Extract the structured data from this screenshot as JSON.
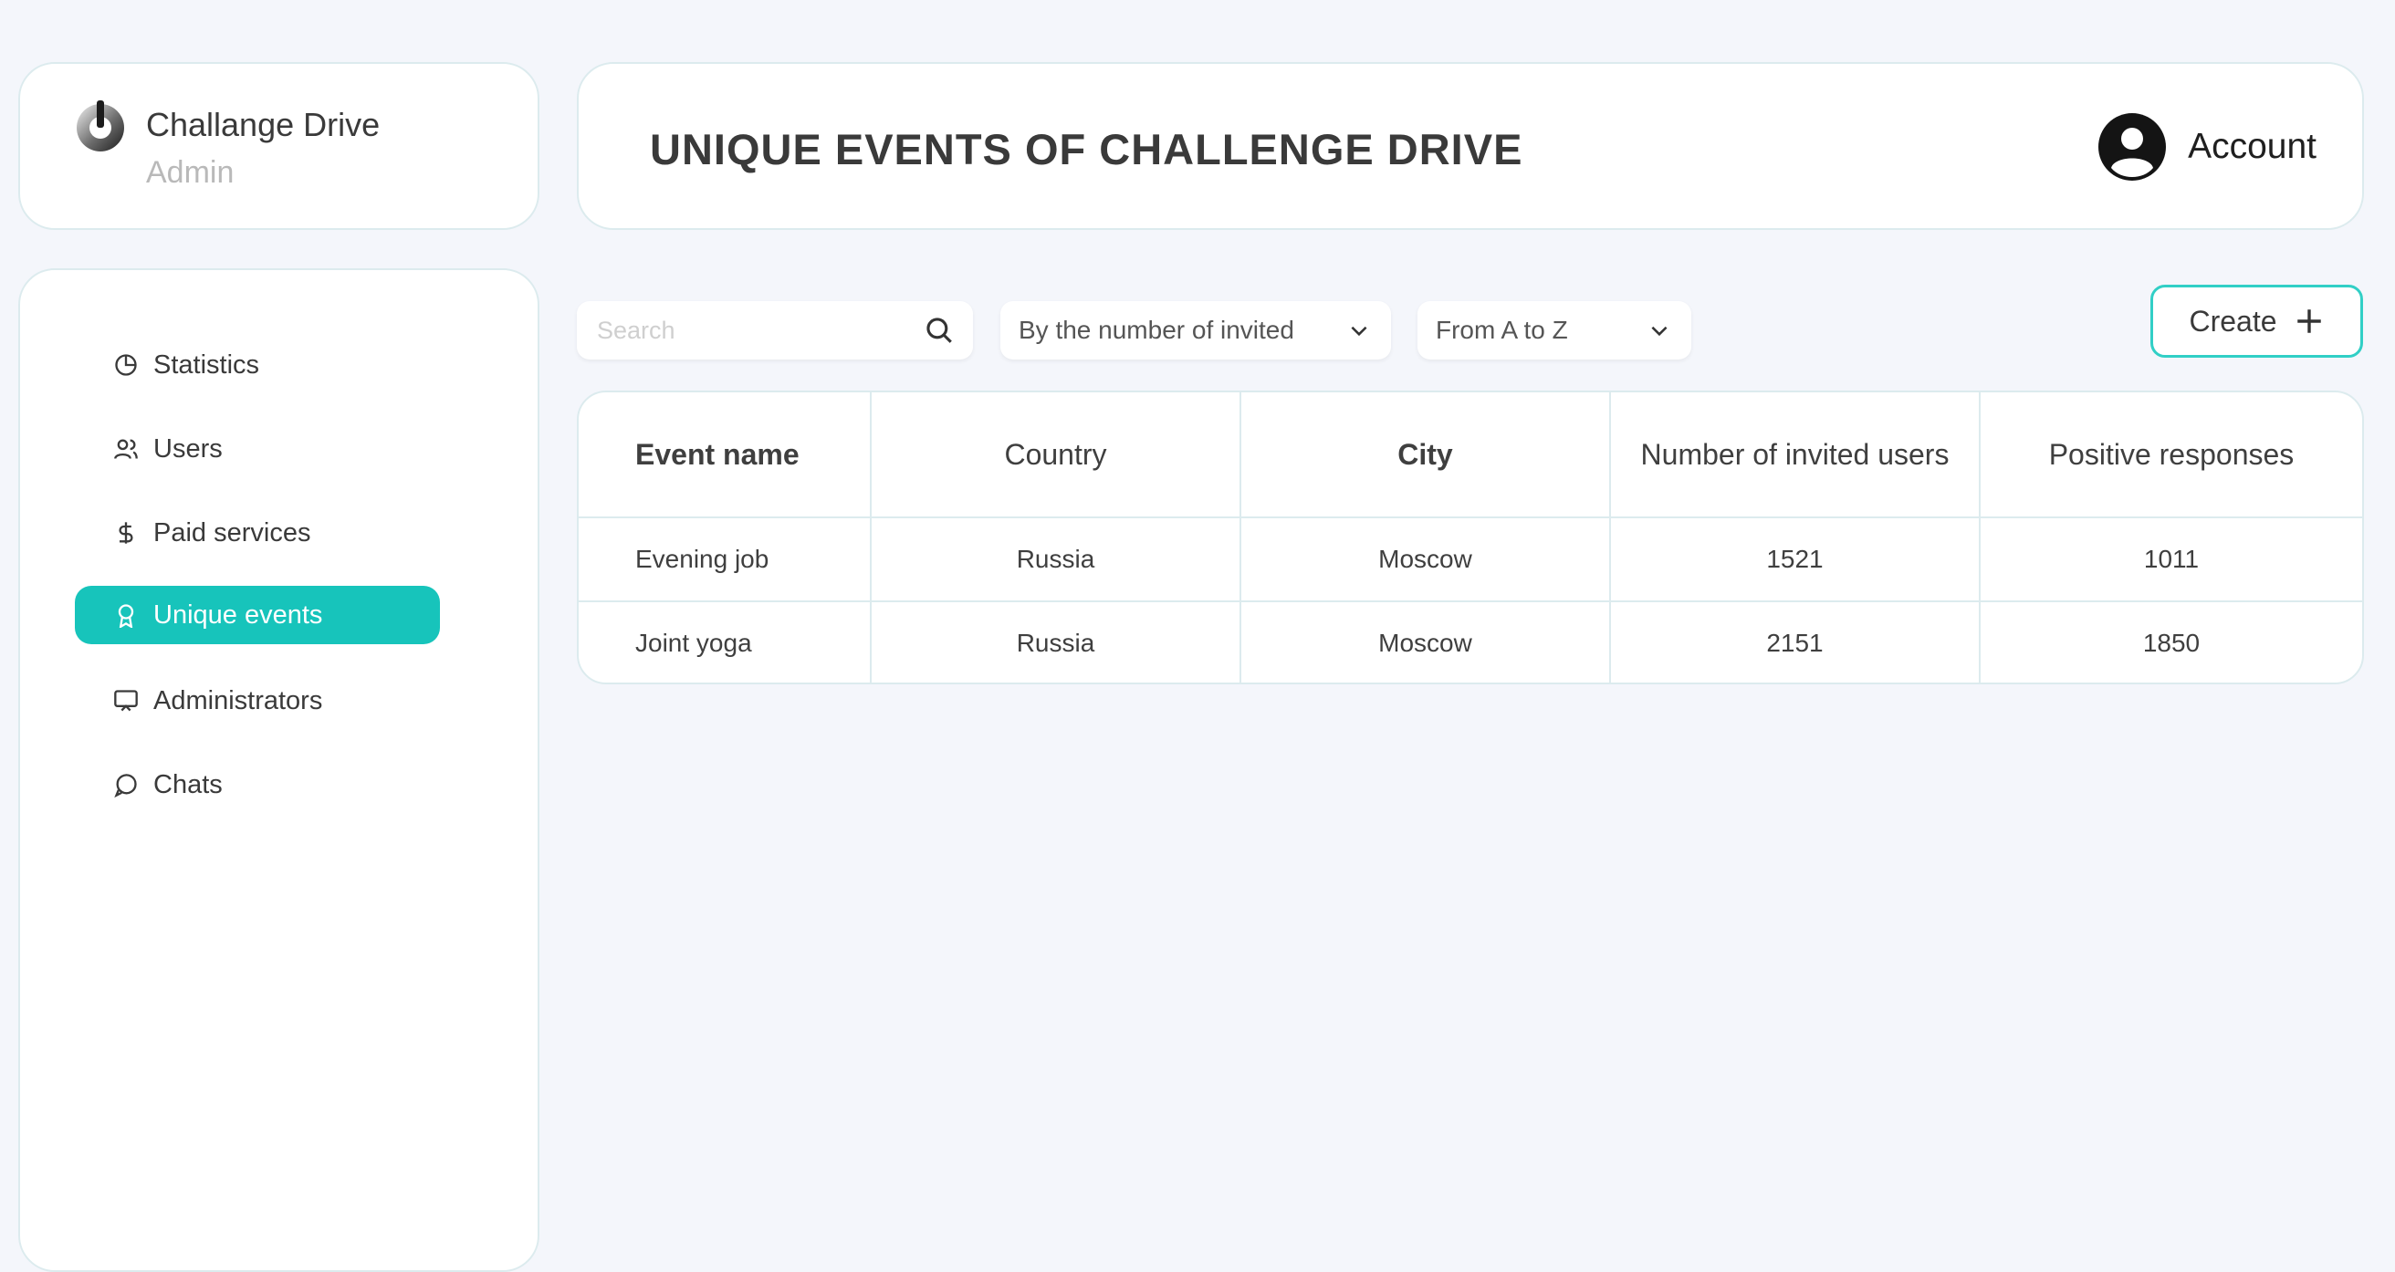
{
  "brand": {
    "title": "Challange Drive",
    "role": "Admin"
  },
  "header": {
    "title": "UNIQUE EVENTS OF CHALLENGE DRIVE",
    "account_label": "Account"
  },
  "sidebar": {
    "items": [
      {
        "label": "Statistics",
        "icon": "pie-chart-icon",
        "active": false
      },
      {
        "label": "Users",
        "icon": "users-icon",
        "active": false
      },
      {
        "label": "Paid services",
        "icon": "dollar-icon",
        "active": false
      },
      {
        "label": "Unique events",
        "icon": "award-icon",
        "active": true
      },
      {
        "label": "Administrators",
        "icon": "monitor-icon",
        "active": false
      },
      {
        "label": "Chats",
        "icon": "chat-bubble-icon",
        "active": false
      }
    ]
  },
  "toolbar": {
    "search_placeholder": "Search",
    "sort_by_label": "By the number of invited",
    "order_label": "From A to Z",
    "create_label": "Create"
  },
  "table": {
    "columns": [
      "Event name",
      "Country",
      "City",
      "Number of invited users",
      "Positive responses"
    ],
    "rows": [
      [
        "Evening job",
        "Russia",
        "Moscow",
        "1521",
        "1011"
      ],
      [
        "Joint yoga",
        "Russia",
        "Moscow",
        "2151",
        "1850"
      ]
    ]
  },
  "colors": {
    "accent": "#17c4bb",
    "accent_border": "#31cfc6",
    "background": "#f4f6fb",
    "card_border": "#dcebee"
  }
}
